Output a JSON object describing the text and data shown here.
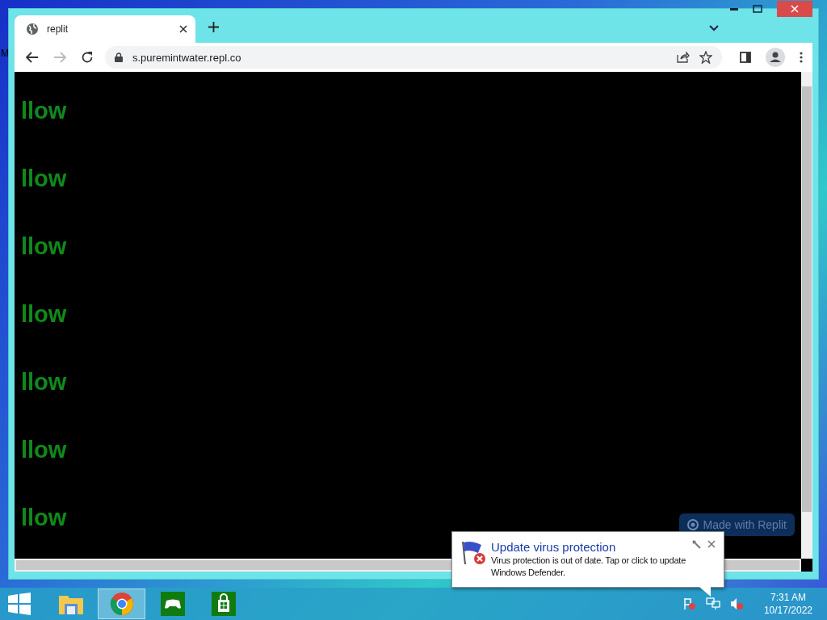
{
  "desktop": {
    "icon_label": "M"
  },
  "browser": {
    "tabs": [
      {
        "title": "replit",
        "selected": true
      }
    ],
    "address": "s.puremintwater.repl.co",
    "content_lines": [
      "llow",
      "llow",
      "llow",
      "llow",
      "llow",
      "llow",
      "llow"
    ],
    "badge": "Made with Replit"
  },
  "notification": {
    "title": "Update virus protection",
    "message": "Virus protection is out of date. Tap or click to update Windows Defender."
  },
  "taskbar": {
    "apps": [
      {
        "kind": "explorer",
        "selected": false
      },
      {
        "kind": "chrome",
        "selected": true
      },
      {
        "kind": "xbox",
        "selected": false
      },
      {
        "kind": "store",
        "selected": false
      }
    ],
    "time": "7:31 AM",
    "date": "10/17/2022"
  }
}
